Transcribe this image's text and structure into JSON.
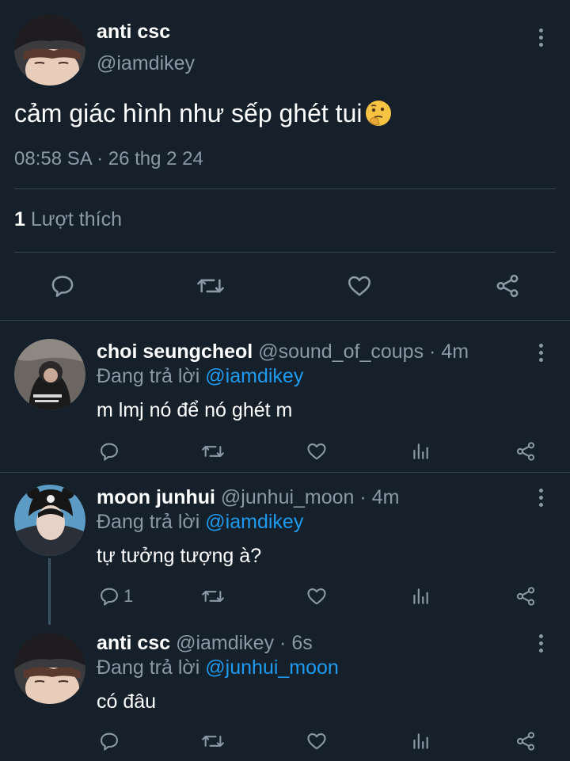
{
  "main_tweet": {
    "author_name": "anti csc",
    "author_handle": "@iamdikey",
    "text": "cảm giác hình như sếp ghét tui",
    "emoji": "thinking-face",
    "timestamp": "08:58 SA · 26 thg 2 24",
    "likes_count": "1",
    "likes_label": "Lượt thích",
    "actions": [
      "reply-icon",
      "retweet-icon",
      "like-icon",
      "share-icon"
    ]
  },
  "replies": [
    {
      "author_name": "choi seungcheol",
      "author_handle": "@sound_of_coups",
      "time": "· 4m",
      "replying_prefix": "Đang trả lời",
      "replying_to": "@iamdikey",
      "text": "m lmj nó để nó ghét m",
      "reply_count": ""
    },
    {
      "author_name": "moon junhui",
      "author_handle": "@junhui_moon",
      "time": "· 4m",
      "replying_prefix": "Đang trả lời",
      "replying_to": "@iamdikey",
      "text": "tự tưởng tượng à?",
      "reply_count": "1"
    },
    {
      "author_name": "anti csc",
      "author_handle": "@iamdikey",
      "time": "· 6s",
      "replying_prefix": "Đang trả lời",
      "replying_to": "@junhui_moon",
      "text": "có đâu",
      "reply_count": ""
    }
  ],
  "colors": {
    "background": "#15202b",
    "muted": "#8b98a5",
    "link": "#1d9bf0",
    "divider": "#38444d"
  }
}
